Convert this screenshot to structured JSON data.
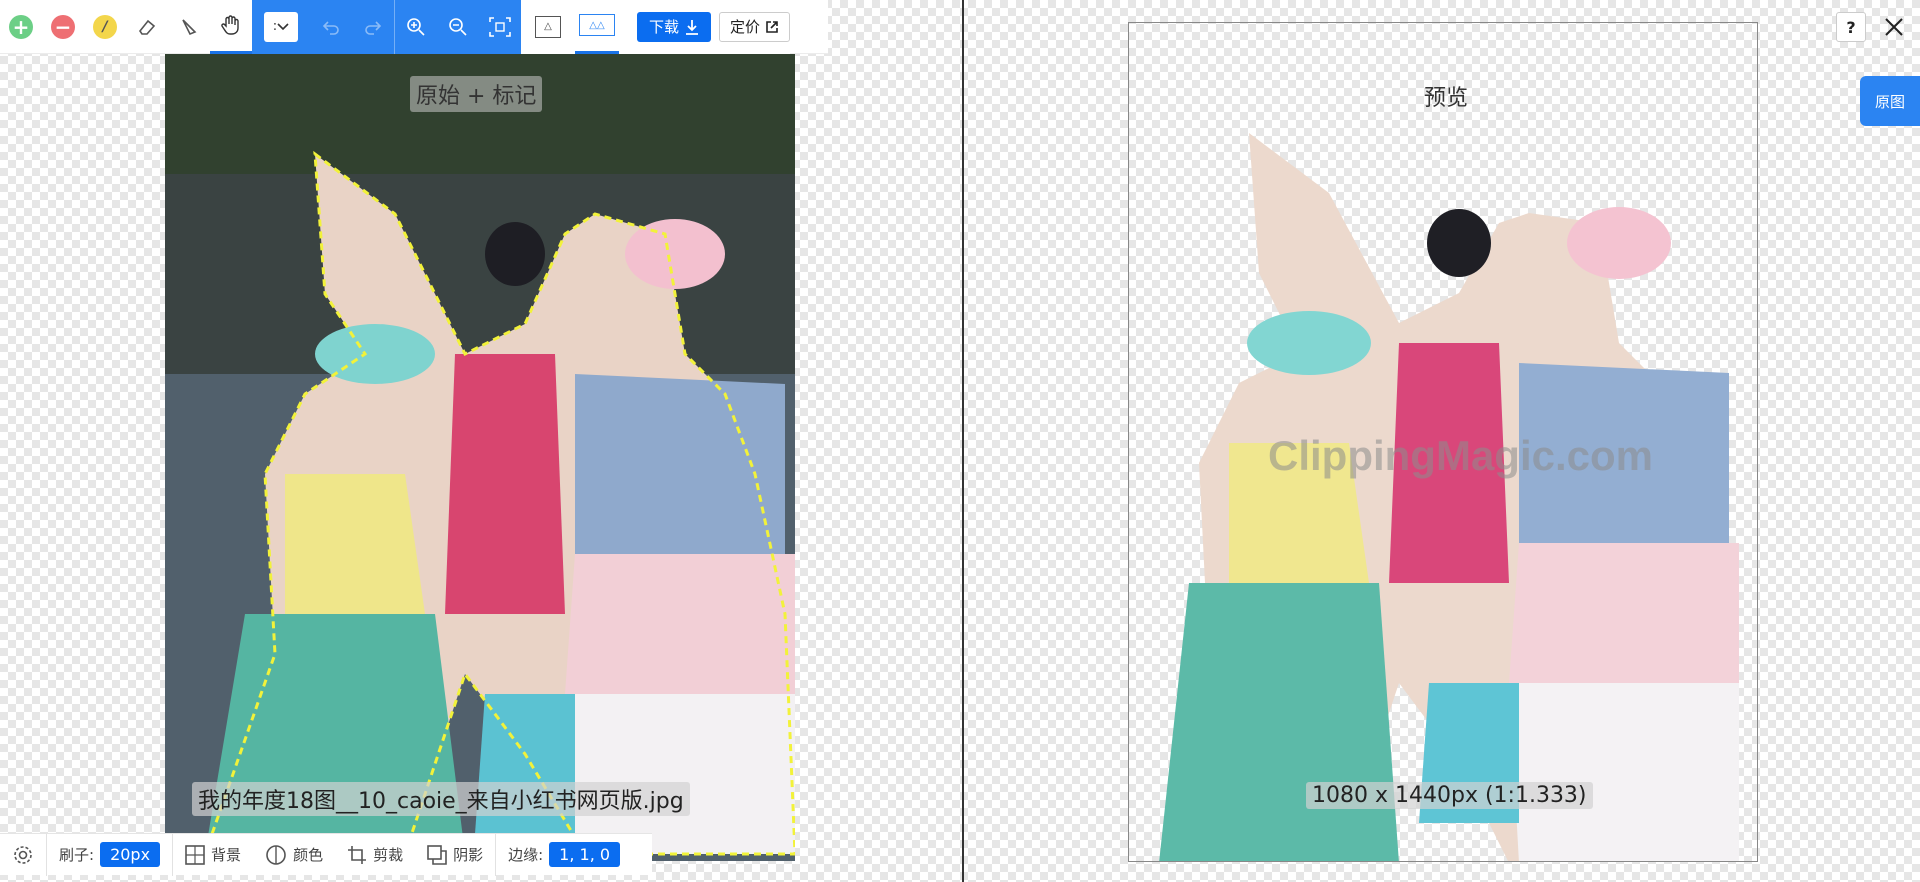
{
  "toolbar": {
    "download_label": "下载",
    "price_label": "定价",
    "select_value": ":"
  },
  "left_pane": {
    "label": "原始 + 标记",
    "filename": "我的年度18图__10_caoie_来自小红书网页版.jpg"
  },
  "right_pane": {
    "label": "预览",
    "dimensions": "1080 x 1440px (1:1.333)",
    "watermark": "ClippingMagic.com"
  },
  "top_right": {
    "help_label": "?",
    "original_tab": "原图"
  },
  "bottom_bar": {
    "brush_label": "刷子:",
    "brush_value": "20px",
    "background_label": "背景",
    "color_label": "颜色",
    "crop_label": "剪裁",
    "shadow_label": "阴影",
    "edge_label": "边缘:",
    "edge_value": "1, 1, 0"
  },
  "icons": [
    "add-icon",
    "remove-icon",
    "hair-brush-icon",
    "eraser-icon",
    "scalpel-icon",
    "hand-icon",
    "undo-icon",
    "redo-icon",
    "zoom-in-icon",
    "zoom-out-icon",
    "fit-icon",
    "single-view-icon",
    "dual-view-icon",
    "download-icon",
    "external-link-icon",
    "settings-icon",
    "close-icon"
  ],
  "colors": {
    "accent": "#2b84f2",
    "button_blue": "#0b6df0",
    "keep_green": "#6ccf86",
    "remove_red": "#ee6f73",
    "hair_yellow": "#f3d64b"
  }
}
